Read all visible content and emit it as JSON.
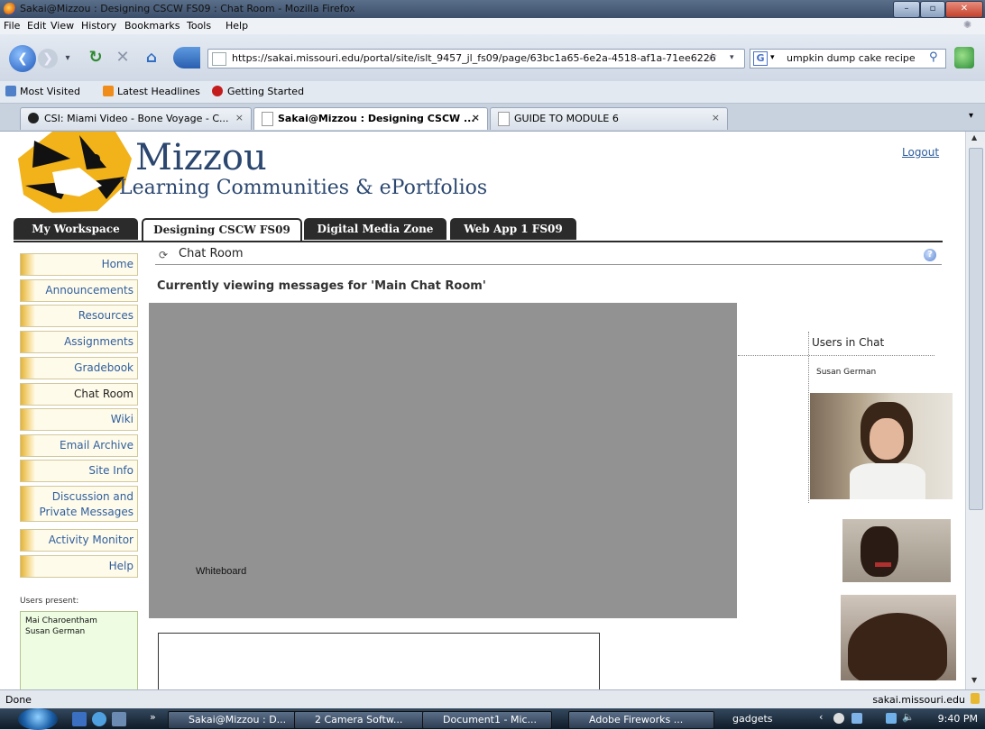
{
  "window": {
    "title": "Sakai@Mizzou : Designing CSCW FS09 : Chat Room - Mozilla Firefox",
    "controls": [
      "minimize",
      "maximize",
      "close"
    ]
  },
  "menu": [
    "File",
    "Edit",
    "View",
    "History",
    "Bookmarks",
    "Tools",
    "Help"
  ],
  "nav": {
    "url": "https://sakai.missouri.edu/portal/site/islt_9457_jl_fs09/page/63bc1a65-6e2a-4518-af1a-71ee6226",
    "search_value": "umpkin dump cake recipe",
    "search_engine": "G"
  },
  "bookmarks": [
    "Most Visited",
    "Latest Headlines",
    "Getting Started"
  ],
  "browser_tabs": [
    {
      "label": "CSI: Miami Video - Bone Voyage - C...",
      "close": "×"
    },
    {
      "label": "Sakai@Mizzou : Designing CSCW ...",
      "close": "×"
    },
    {
      "label": "GUIDE TO MODULE 6",
      "close": "×"
    }
  ],
  "page": {
    "brand_title": "Mizzou",
    "brand_subtitle": "Learning Communities & ePortfolios",
    "logout": "Logout",
    "site_tabs": [
      "My Workspace",
      "Designing CSCW FS09",
      "Digital Media Zone",
      "Web App 1 FS09"
    ],
    "left_nav": [
      "Home",
      "Announcements",
      "Resources",
      "Assignments",
      "Gradebook",
      "Chat Room",
      "Wiki",
      "Email Archive",
      "Site Info",
      "Discussion and Private Messages",
      "Activity Monitor",
      "Help"
    ],
    "current_nav": "Chat Room",
    "users_present_label": "Users present:",
    "users_present": [
      "Mai Charoentham",
      "Susan German"
    ],
    "tool_title": "Chat Room",
    "viewing_text": "Currently viewing messages for 'Main Chat Room'",
    "whiteboard_label": "Whiteboard",
    "users_in_chat_title": "Users in Chat",
    "users_in_chat": [
      "Susan German"
    ]
  },
  "status": {
    "left": "Done",
    "right": "sakai.missouri.edu"
  },
  "taskbar": {
    "items": [
      "Sakai@Mizzou : D...",
      "2 Camera Softw...",
      "Document1 - Mic...",
      "Adobe Fireworks ...",
      "gadgets"
    ],
    "clock": "9:40 PM"
  },
  "colors": {
    "brand_blue": "#2b4770",
    "link_blue": "#2e5e9e",
    "whiteboard_gray": "#929292",
    "nav_gold": "#e4b43a"
  }
}
